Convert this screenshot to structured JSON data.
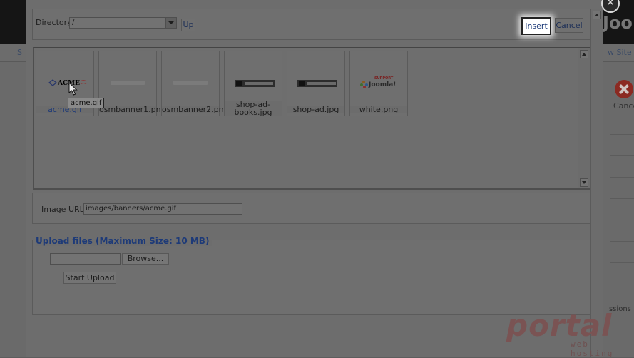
{
  "background": {
    "logo_fragment": "Joo",
    "nav_left_fragment": "S",
    "nav_right_fragment": "w Site",
    "cancel_label": "Cance",
    "sessions_fragment": "ssions"
  },
  "dialog": {
    "close_glyph": "×",
    "directory": {
      "label": "Directory",
      "selected": "/",
      "up_label": "Up"
    },
    "insert_label": "Insert",
    "cancel_label": "Cancel",
    "images": [
      {
        "name": "acme.gif",
        "selected": true,
        "thumb": "acme"
      },
      {
        "name": "osmbanner1.png",
        "selected": false,
        "thumb": "faint"
      },
      {
        "name": "osmbanner2.png",
        "selected": false,
        "thumb": "faint"
      },
      {
        "name": "shop-ad-books.jpg",
        "caption_lines": [
          "shop-ad-",
          "books.jpg"
        ],
        "selected": false,
        "thumb": "dark"
      },
      {
        "name": "shop-ad.jpg",
        "selected": false,
        "thumb": "dark"
      },
      {
        "name": "white.png",
        "selected": false,
        "thumb": "joomla",
        "badge_top": "SUPPORT",
        "badge_main": "Joomla!"
      }
    ],
    "acme_logo_text": "ACME",
    "tooltip": "acme.gif",
    "image_url": {
      "label": "Image URL",
      "value": "images/banners/acme.gif"
    },
    "upload": {
      "legend": "Upload files (Maximum Size: 10 MB)",
      "browse_label": "Browse...",
      "start_label": "Start Upload"
    }
  },
  "watermark": {
    "main": "portal",
    "sub": "web hosting"
  },
  "colors": {
    "link_blue": "#1d3a78",
    "overlay_gray": "#6d6d6d",
    "watermark": "#7a5353"
  }
}
